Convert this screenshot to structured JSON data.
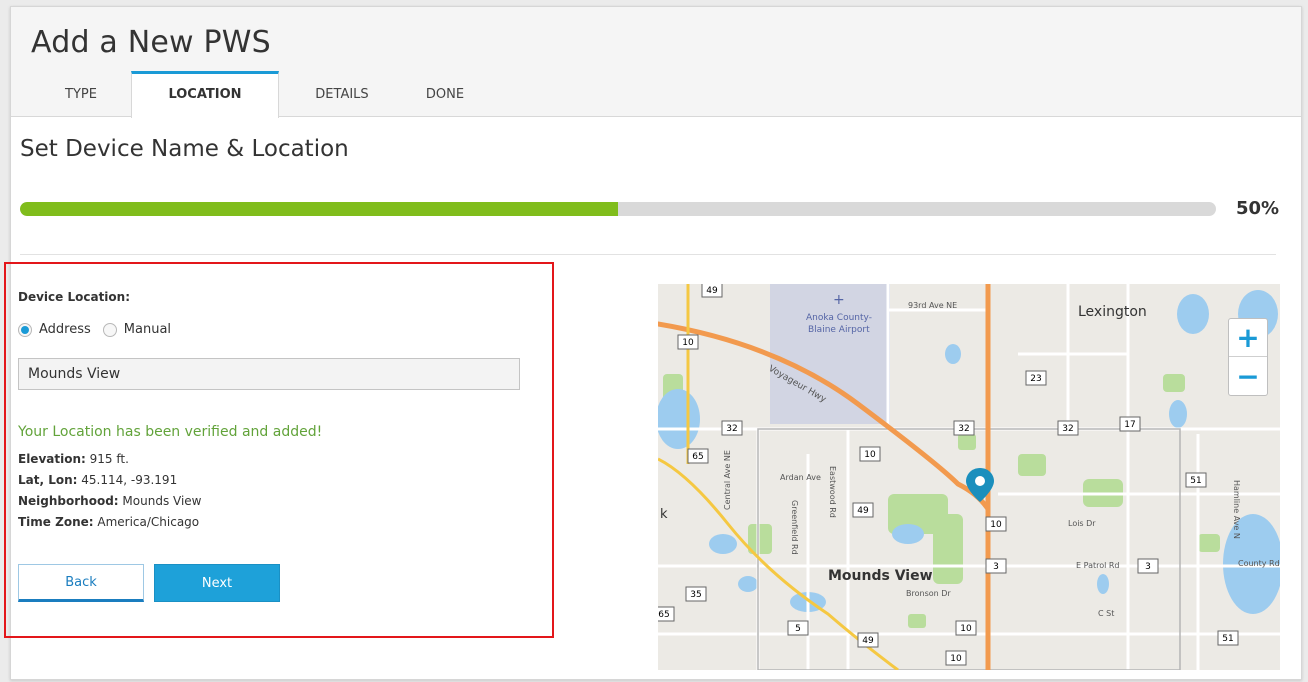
{
  "header": {
    "title": "Add a New PWS",
    "tabs": [
      {
        "label": "TYPE"
      },
      {
        "label": "LOCATION"
      },
      {
        "label": "DETAILS"
      },
      {
        "label": "DONE"
      }
    ],
    "active_tab": "LOCATION"
  },
  "section": {
    "title": "Set Device Name & Location"
  },
  "progress": {
    "value_percent": 50,
    "label": "50%",
    "color": "#80bd1c"
  },
  "form": {
    "location_label": "Device Location:",
    "radio_options": [
      {
        "label": "Address",
        "checked": true
      },
      {
        "label": "Manual",
        "checked": false
      }
    ],
    "address_value": "Mounds View",
    "verified_message": "Your Location has been verified and added!",
    "info": {
      "elevation_label": "Elevation:",
      "elevation_value": " 915 ft.",
      "latlon_label": "Lat, Lon:",
      "latlon_value": " 45.114, -93.191",
      "neighborhood_label": "Neighborhood:",
      "neighborhood_value": " Mounds View",
      "timezone_label": "Time Zone:",
      "timezone_value": " America/Chicago"
    },
    "back_label": "Back",
    "next_label": "Next"
  },
  "map": {
    "labels": {
      "lexington": "Lexington",
      "airport": "Anoka County-\nBlaine Airport",
      "mounds_view": "Mounds View",
      "ave93": "93rd Ave NE",
      "voyageur": "Voyageur Hwy",
      "ardan": "Ardan Ave",
      "eastwood": "Eastwood Rd",
      "greenfield": "Greenfield Rd",
      "central": "Central Ave NE",
      "bronson": "Bronson Dr",
      "lois": "Lois Dr",
      "epatrol": "E Patrol Rd",
      "county": "County Rd",
      "cst": "C St",
      "hamline": "Hamline Ave N",
      "kk": "k"
    },
    "shields": [
      "49",
      "10",
      "23",
      "32",
      "32",
      "32",
      "17",
      "65",
      "10",
      "49",
      "10",
      "51",
      "3",
      "3",
      "35",
      "5",
      "49",
      "10",
      "10",
      "51",
      "65"
    ],
    "zoom_in": "+",
    "zoom_out": "−",
    "colors": {
      "highway": "#f29a4e",
      "water": "#9dccef",
      "park": "#b9dd9c",
      "airport": "#d2d5e3",
      "marker": "#1b8fbd"
    }
  }
}
